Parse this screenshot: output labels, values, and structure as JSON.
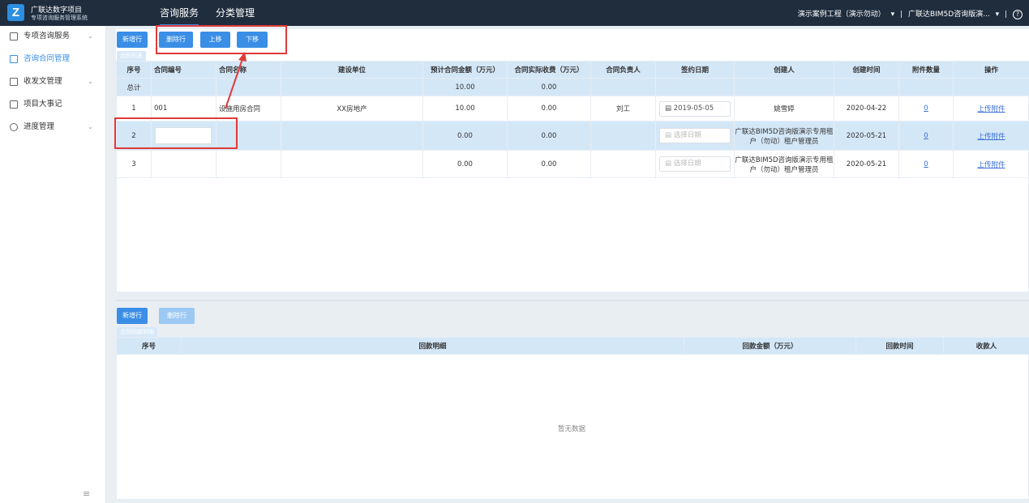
{
  "header": {
    "brand_title": "广联达数字项目",
    "brand_subtitle": "专项咨询服务管理系统",
    "logo_letter": "Z",
    "nav": [
      "咨询服务",
      "分类管理"
    ],
    "project": "演示案例工程（演示勿动）",
    "project_chevron": "▾",
    "sep1": "|",
    "tenant": "广联达BIM5D咨询版演...",
    "tenant_chevron": "▾",
    "sep2": "|",
    "help_icon": "?"
  },
  "sidebar": {
    "items": [
      {
        "label": "专项咨询服务",
        "chevron": "⌄"
      },
      {
        "label": "咨询合同管理",
        "chevron": ""
      },
      {
        "label": "收发文管理",
        "chevron": "⌄"
      },
      {
        "label": "项目大事记",
        "chevron": ""
      },
      {
        "label": "进度管理",
        "chevron": "⌄"
      }
    ],
    "collapse_icon": "≡"
  },
  "contract_toolbar": {
    "add_row": "新增行",
    "delete_row": "删除行",
    "move_up": "上移",
    "move_down": "下移"
  },
  "contract_table": {
    "caption": "合同列表",
    "headers": [
      "序号",
      "合同编号",
      "合同名称",
      "建设单位",
      "预计合同金额（万元）",
      "合同实际收费（万元）",
      "合同负责人",
      "签约日期",
      "创建人",
      "创建时间",
      "附件数量",
      "操作"
    ],
    "summary": {
      "label": "总计",
      "estimated": "10.00",
      "actual": "0.00"
    },
    "rows": [
      {
        "index": "1",
        "code": "001",
        "name": "设施用房合同",
        "unit": "XX房地产",
        "estimated": "10.00",
        "actual": "0.00",
        "owner": "刘工",
        "date": "2019-05-05",
        "creator": "姚雪婷",
        "created": "2020-04-22",
        "attachments": "0",
        "action": "上传附件"
      },
      {
        "index": "2",
        "code": "",
        "name": "",
        "unit": "",
        "estimated": "0.00",
        "actual": "0.00",
        "owner": "",
        "date_placeholder": "选择日期",
        "creator": "广联达BIM5D咨询版演示专用租户（勿动）租户管理员",
        "created": "2020-05-21",
        "attachments": "0",
        "action": "上传附件"
      },
      {
        "index": "3",
        "code": "",
        "name": "",
        "unit": "",
        "estimated": "0.00",
        "actual": "0.00",
        "owner": "",
        "date_placeholder": "选择日期",
        "creator": "广联达BIM5D咨询版演示专用租户（勿动）租户管理员",
        "created": "2020-05-21",
        "attachments": "0",
        "action": "上传附件"
      }
    ]
  },
  "payment_toolbar": {
    "add_row": "新增行",
    "delete_row": "删除行"
  },
  "payment_table": {
    "caption": "合同回款明细",
    "headers": [
      "序号",
      "回款明细",
      "回款金额（万元）",
      "回款时间",
      "收款人"
    ],
    "empty_text": "暂无数据"
  },
  "colors": {
    "topbar": "#1f2d3d",
    "accent": "#3a8ee6",
    "header_bg": "#d4e7f7",
    "annotation": "#e03a3a"
  }
}
